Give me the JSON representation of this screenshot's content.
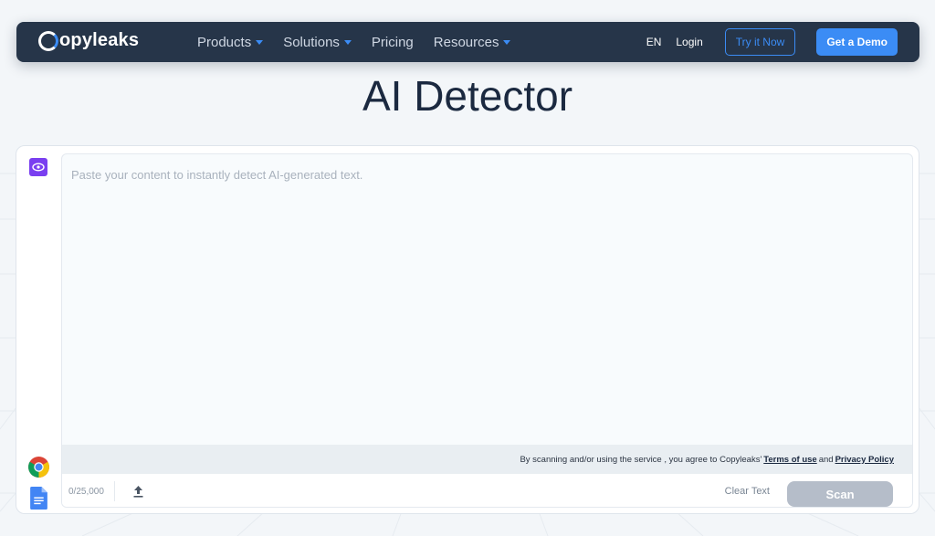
{
  "navbar": {
    "logo_text": "opyleaks",
    "links": [
      {
        "label": "Products",
        "dropdown": true
      },
      {
        "label": "Solutions",
        "dropdown": true
      },
      {
        "label": "Pricing",
        "dropdown": false
      },
      {
        "label": "Resources",
        "dropdown": true
      }
    ],
    "language": "EN",
    "login_label": "Login",
    "try_label": "Try it Now",
    "demo_label": "Get a Demo"
  },
  "page": {
    "title": "AI Detector"
  },
  "editor": {
    "placeholder": "Paste your content to instantly detect AI-generated text.",
    "terms_prefix": "By scanning and/or using the service , you agree to Copyleaks'",
    "terms_link": "Terms of use",
    "terms_and": "and",
    "privacy_link": "Privacy Policy",
    "counter": "0/25,000",
    "clear_label": "Clear Text",
    "scan_label": "Scan"
  },
  "icons": {
    "side_top": "eye-icon",
    "side_chrome": "chrome-icon",
    "side_docs": "google-docs-icon",
    "upload": "upload-icon"
  },
  "colors": {
    "nav_bg": "#263549",
    "accent": "#3b8cf5",
    "title": "#1b2940",
    "eye_bg": "#7a3ff0",
    "scan_disabled": "#b5bdc9"
  }
}
